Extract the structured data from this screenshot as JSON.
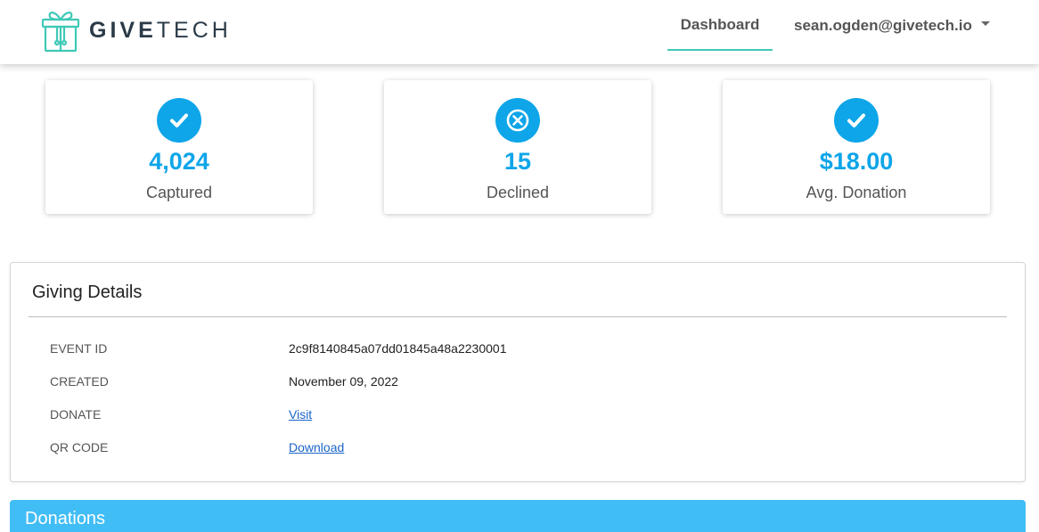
{
  "brand": {
    "name_bold": "GIVE",
    "name_light": "TECH",
    "icon": "gift-icon",
    "accent_color": "#3fc9b6"
  },
  "nav": {
    "dashboard_label": "Dashboard",
    "user_email": "sean.ogden@givetech.io",
    "user_menu_icon": "caret-down-icon"
  },
  "stats": [
    {
      "value": "4,024",
      "label": "Captured",
      "icon": "check-circle-icon"
    },
    {
      "value": "15",
      "label": "Declined",
      "icon": "x-circle-icon"
    },
    {
      "value": "$18.00",
      "label": "Avg. Donation",
      "icon": "check-circle-icon"
    }
  ],
  "stat_color": "#0ea5e9",
  "giving_details": {
    "title": "Giving Details",
    "rows": [
      {
        "key": "EVENT ID",
        "value": "2c9f8140845a07dd01845a48a2230001"
      },
      {
        "key": "CREATED",
        "value": "November 09, 2022"
      },
      {
        "key": "DONATE",
        "value": "Visit"
      },
      {
        "key": "QR CODE",
        "value": "Download"
      }
    ]
  },
  "donations": {
    "title": "Donations",
    "color": "#41bdf6"
  }
}
